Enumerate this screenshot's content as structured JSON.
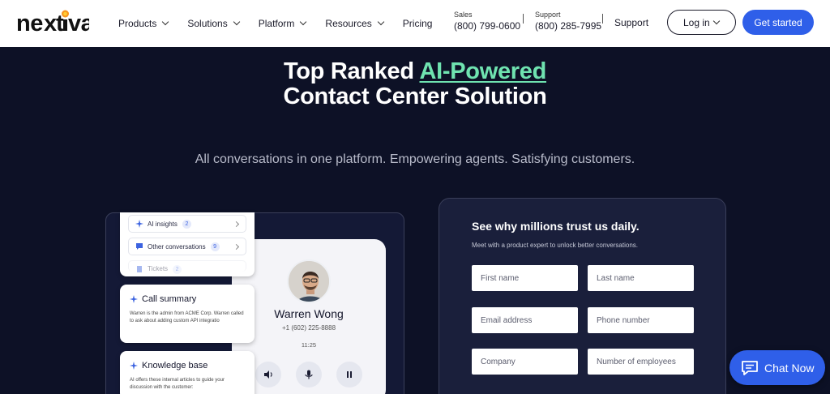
{
  "header": {
    "logo_text": "nextiva",
    "nav": [
      {
        "label": "Products"
      },
      {
        "label": "Solutions"
      },
      {
        "label": "Platform"
      },
      {
        "label": "Resources"
      },
      {
        "label": "Pricing"
      }
    ],
    "sales": {
      "label": "Sales",
      "number": "(800) 799-0600"
    },
    "support_phone": {
      "label": "Support",
      "number": "(800) 285-7995"
    },
    "support_link": "Support",
    "login_label": "Log in",
    "get_started_label": "Get started"
  },
  "hero": {
    "title_prefix": "Top Ranked ",
    "title_highlight": "AI-Powered",
    "title_line2": "Contact Center Solution",
    "subtitle": "All conversations in one platform. Empowering agents. Satisfying customers."
  },
  "showcase": {
    "list": [
      {
        "label": "AI insights",
        "count": "2",
        "icon": "sparkle-icon"
      },
      {
        "label": "Other conversations",
        "count": "9",
        "icon": "chat-bubble-icon"
      },
      {
        "label": "Tickets",
        "count": "2",
        "icon": "document-icon"
      }
    ],
    "call_summary": {
      "title": "Call summary",
      "body": "Warren is the admin from ACME Corp. Warren called to ask about adding custom API integratio"
    },
    "knowledge_base": {
      "title": "Knowledge base",
      "body": "AI offers these internal articles to guide your discussion with the customer:"
    },
    "caller": {
      "name": "Warren Wong",
      "phone": "+1 (602) 225-8888",
      "time": "11:25"
    }
  },
  "form": {
    "title": "See why millions trust us daily.",
    "subtitle": "Meet with a product expert to unlock better conversations.",
    "fields": {
      "first_name": "First name",
      "last_name": "Last name",
      "email": "Email address",
      "phone": "Phone number",
      "company": "Company",
      "employees": "Number of employees"
    }
  },
  "chat": {
    "label": "Chat Now"
  },
  "colors": {
    "brand_blue": "#2f5fe9",
    "highlight_green": "#6fe3b0",
    "hero_bg": "#0d1126",
    "logo_orange": "#f7941d"
  }
}
